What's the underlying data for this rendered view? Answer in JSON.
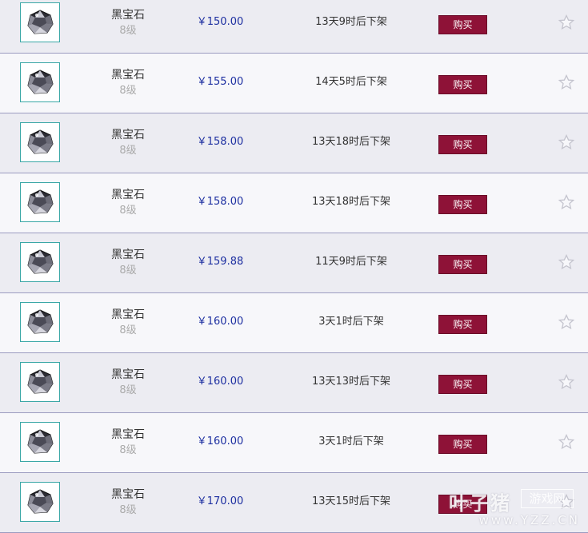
{
  "accent_colors": {
    "buy_button": "#8e1237",
    "price": "#1c2ea0",
    "row_alt_a": "#ececf2",
    "row_alt_b": "#f7f7fa"
  },
  "items": [
    {
      "name": "黑宝石",
      "level": "8级",
      "price": "￥150.00",
      "expire": "13天9时后下架",
      "buy_label": "购买",
      "icon": "black-gem-icon",
      "star_icon": "star-outline-icon"
    },
    {
      "name": "黑宝石",
      "level": "8级",
      "price": "￥155.00",
      "expire": "14天5时后下架",
      "buy_label": "购买",
      "icon": "black-gem-icon",
      "star_icon": "star-outline-icon"
    },
    {
      "name": "黑宝石",
      "level": "8级",
      "price": "￥158.00",
      "expire": "13天18时后下架",
      "buy_label": "购买",
      "icon": "black-gem-icon",
      "star_icon": "star-outline-icon"
    },
    {
      "name": "黑宝石",
      "level": "8级",
      "price": "￥158.00",
      "expire": "13天18时后下架",
      "buy_label": "购买",
      "icon": "black-gem-icon",
      "star_icon": "star-outline-icon"
    },
    {
      "name": "黑宝石",
      "level": "8级",
      "price": "￥159.88",
      "expire": "11天9时后下架",
      "buy_label": "购买",
      "icon": "black-gem-icon",
      "star_icon": "star-outline-icon"
    },
    {
      "name": "黑宝石",
      "level": "8级",
      "price": "￥160.00",
      "expire": "3天1时后下架",
      "buy_label": "购买",
      "icon": "black-gem-icon",
      "star_icon": "star-outline-icon"
    },
    {
      "name": "黑宝石",
      "level": "8级",
      "price": "￥160.00",
      "expire": "13天13时后下架",
      "buy_label": "购买",
      "icon": "black-gem-icon",
      "star_icon": "star-outline-icon"
    },
    {
      "name": "黑宝石",
      "level": "8级",
      "price": "￥160.00",
      "expire": "3天1时后下架",
      "buy_label": "购买",
      "icon": "black-gem-icon",
      "star_icon": "star-outline-icon"
    },
    {
      "name": "黑宝石",
      "level": "8级",
      "price": "￥170.00",
      "expire": "13天15时后下架",
      "buy_label": "购买",
      "icon": "black-gem-icon",
      "star_icon": "star-outline-icon"
    }
  ],
  "watermark": {
    "main": "叶子猪",
    "badge": "游戏网",
    "url": "www.YZZ.CN"
  }
}
